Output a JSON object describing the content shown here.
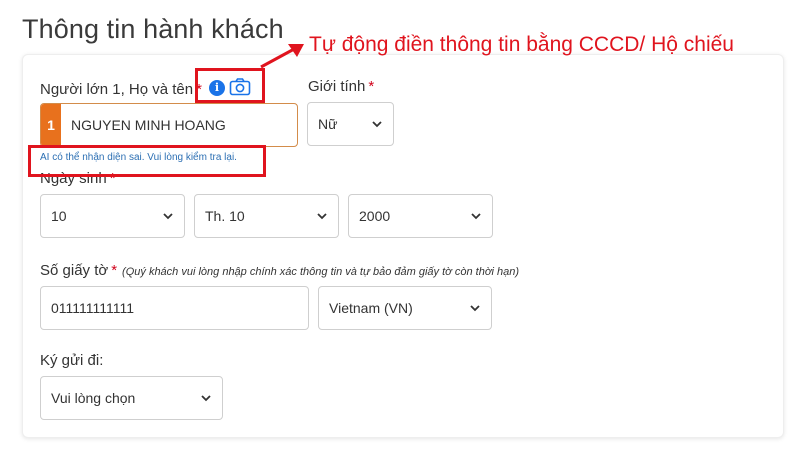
{
  "page": {
    "title": "Thông tin hành khách",
    "annotation": "Tự động điền thông tin bằng CCCD/ Hộ chiếu"
  },
  "passenger": {
    "name_label": "Người lớn 1, Họ và tên",
    "required_mark": "*",
    "index": "1",
    "name_value": "NGUYEN MINH HOANG",
    "ai_note": "AI có thể nhận diện sai. Vui lòng kiểm tra lại.",
    "gender_label": "Giới tính",
    "gender_value": "Nữ",
    "dob_label": "Ngày sinh",
    "dob_day": "10",
    "dob_month": "Th. 10",
    "dob_year": "2000",
    "doc_label": "Số giấy tờ",
    "doc_hint": "(Quý khách vui lòng nhập chính xác thông tin và tự bảo đảm giấy tờ còn thời hạn)",
    "doc_value": "011111111111",
    "nationality_value": "Vietnam (VN)",
    "baggage_label": "Ký gửi đi:",
    "baggage_value": "Vui lòng chọn"
  },
  "icons": {
    "info": "info-icon",
    "camera": "camera-icon",
    "chevron": "chevron-down-icon"
  },
  "colors": {
    "accent": "#e8711d",
    "required": "#d0021b",
    "annotation": "#e0141e",
    "link": "#2c6fb3",
    "info": "#1a73e8"
  }
}
